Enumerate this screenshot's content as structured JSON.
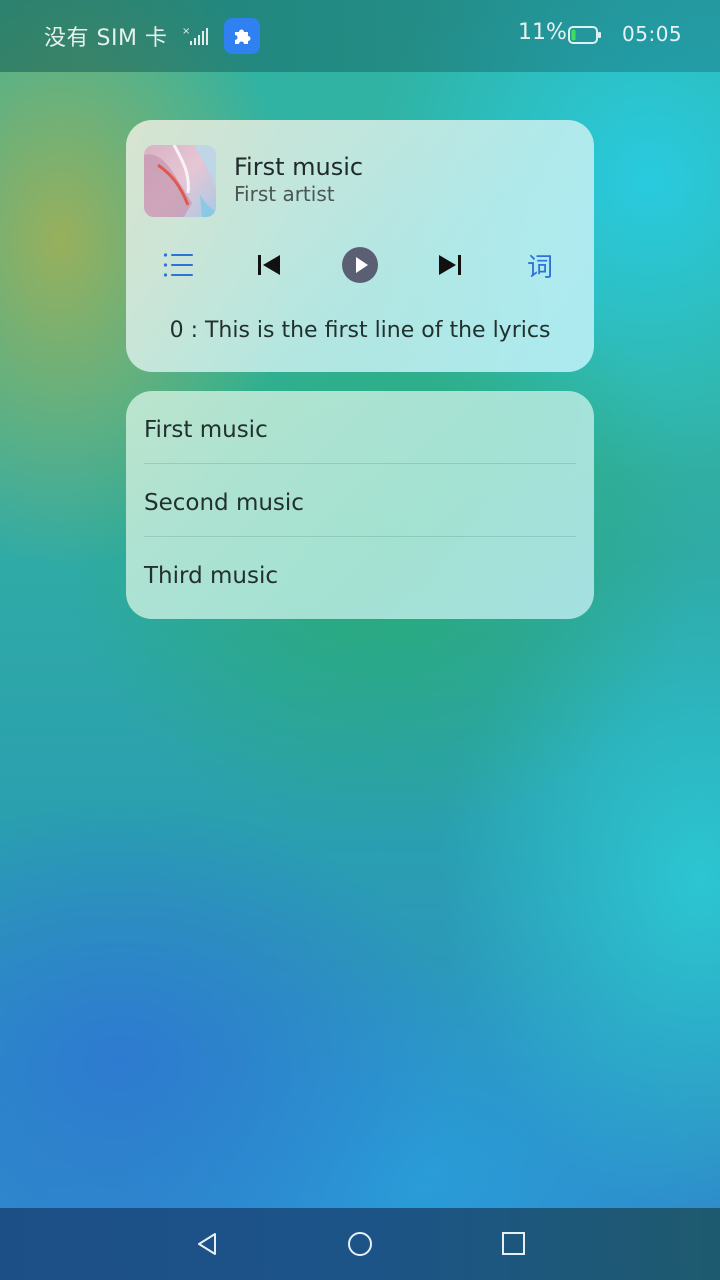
{
  "status_bar": {
    "carrier": "没有 SIM 卡",
    "battery_percent": "11%",
    "battery_level": 0.11,
    "time": "05:05"
  },
  "player": {
    "title": "First music",
    "artist": "First artist",
    "lyrics_button_label": "词",
    "lyric_line": "0 : This is the first line of the lyrics",
    "controls": [
      "list-icon",
      "previous-icon",
      "play-icon",
      "next-icon",
      "lyrics-toggle"
    ],
    "accent_color": "#2e72d8"
  },
  "playlist": {
    "items": [
      "First music",
      "Second music",
      "Third music"
    ]
  },
  "nav_bar": {
    "buttons": [
      "back-icon",
      "home-icon",
      "recents-icon"
    ]
  }
}
